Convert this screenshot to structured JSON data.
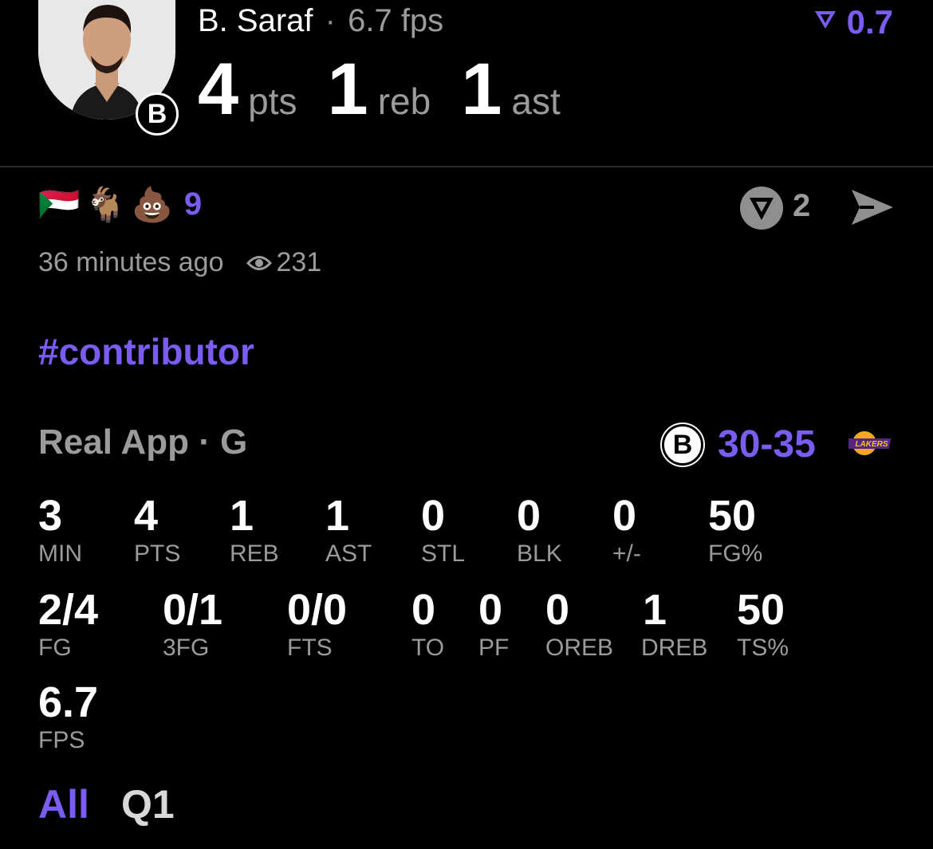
{
  "header": {
    "player_name": "B. Saraf",
    "separator": "·",
    "fps_text": "6.7 fps",
    "fps_change": "0.7",
    "team_badge": "B",
    "stats": [
      {
        "value": "4",
        "unit": "pts"
      },
      {
        "value": "1",
        "unit": "reb"
      },
      {
        "value": "1",
        "unit": "ast"
      }
    ]
  },
  "reactions": {
    "emojis": [
      "🇸🇩",
      "🐐",
      "💩"
    ],
    "count": "9",
    "comment_count": "2"
  },
  "meta": {
    "time_ago": "36 minutes ago",
    "views": "231"
  },
  "hashtag": "#contributor",
  "game": {
    "source": "Real App · G",
    "home_logo": "B",
    "score": "30-35",
    "away_logo": "LAKERS"
  },
  "stats_row1": [
    {
      "value": "3",
      "label": "MIN"
    },
    {
      "value": "4",
      "label": "PTS"
    },
    {
      "value": "1",
      "label": "REB"
    },
    {
      "value": "1",
      "label": "AST"
    },
    {
      "value": "0",
      "label": "STL"
    },
    {
      "value": "0",
      "label": "BLK"
    },
    {
      "value": "0",
      "label": "+/-"
    },
    {
      "value": "50",
      "label": "FG%"
    }
  ],
  "stats_row2": [
    {
      "value": "2/4",
      "label": "FG"
    },
    {
      "value": "0/1",
      "label": "3FG"
    },
    {
      "value": "0/0",
      "label": "FTS"
    },
    {
      "value": "0",
      "label": "TO"
    },
    {
      "value": "0",
      "label": "PF"
    },
    {
      "value": "0",
      "label": "OREB"
    },
    {
      "value": "1",
      "label": "DREB"
    },
    {
      "value": "50",
      "label": "TS%"
    }
  ],
  "stats_row3": [
    {
      "value": "6.7",
      "label": "FPS"
    }
  ],
  "tabs": [
    {
      "label": "All",
      "active": true
    },
    {
      "label": "Q1",
      "active": false
    }
  ],
  "colors": {
    "accent": "#7b5cf0",
    "background": "#000000",
    "muted": "#9b9b9b"
  }
}
